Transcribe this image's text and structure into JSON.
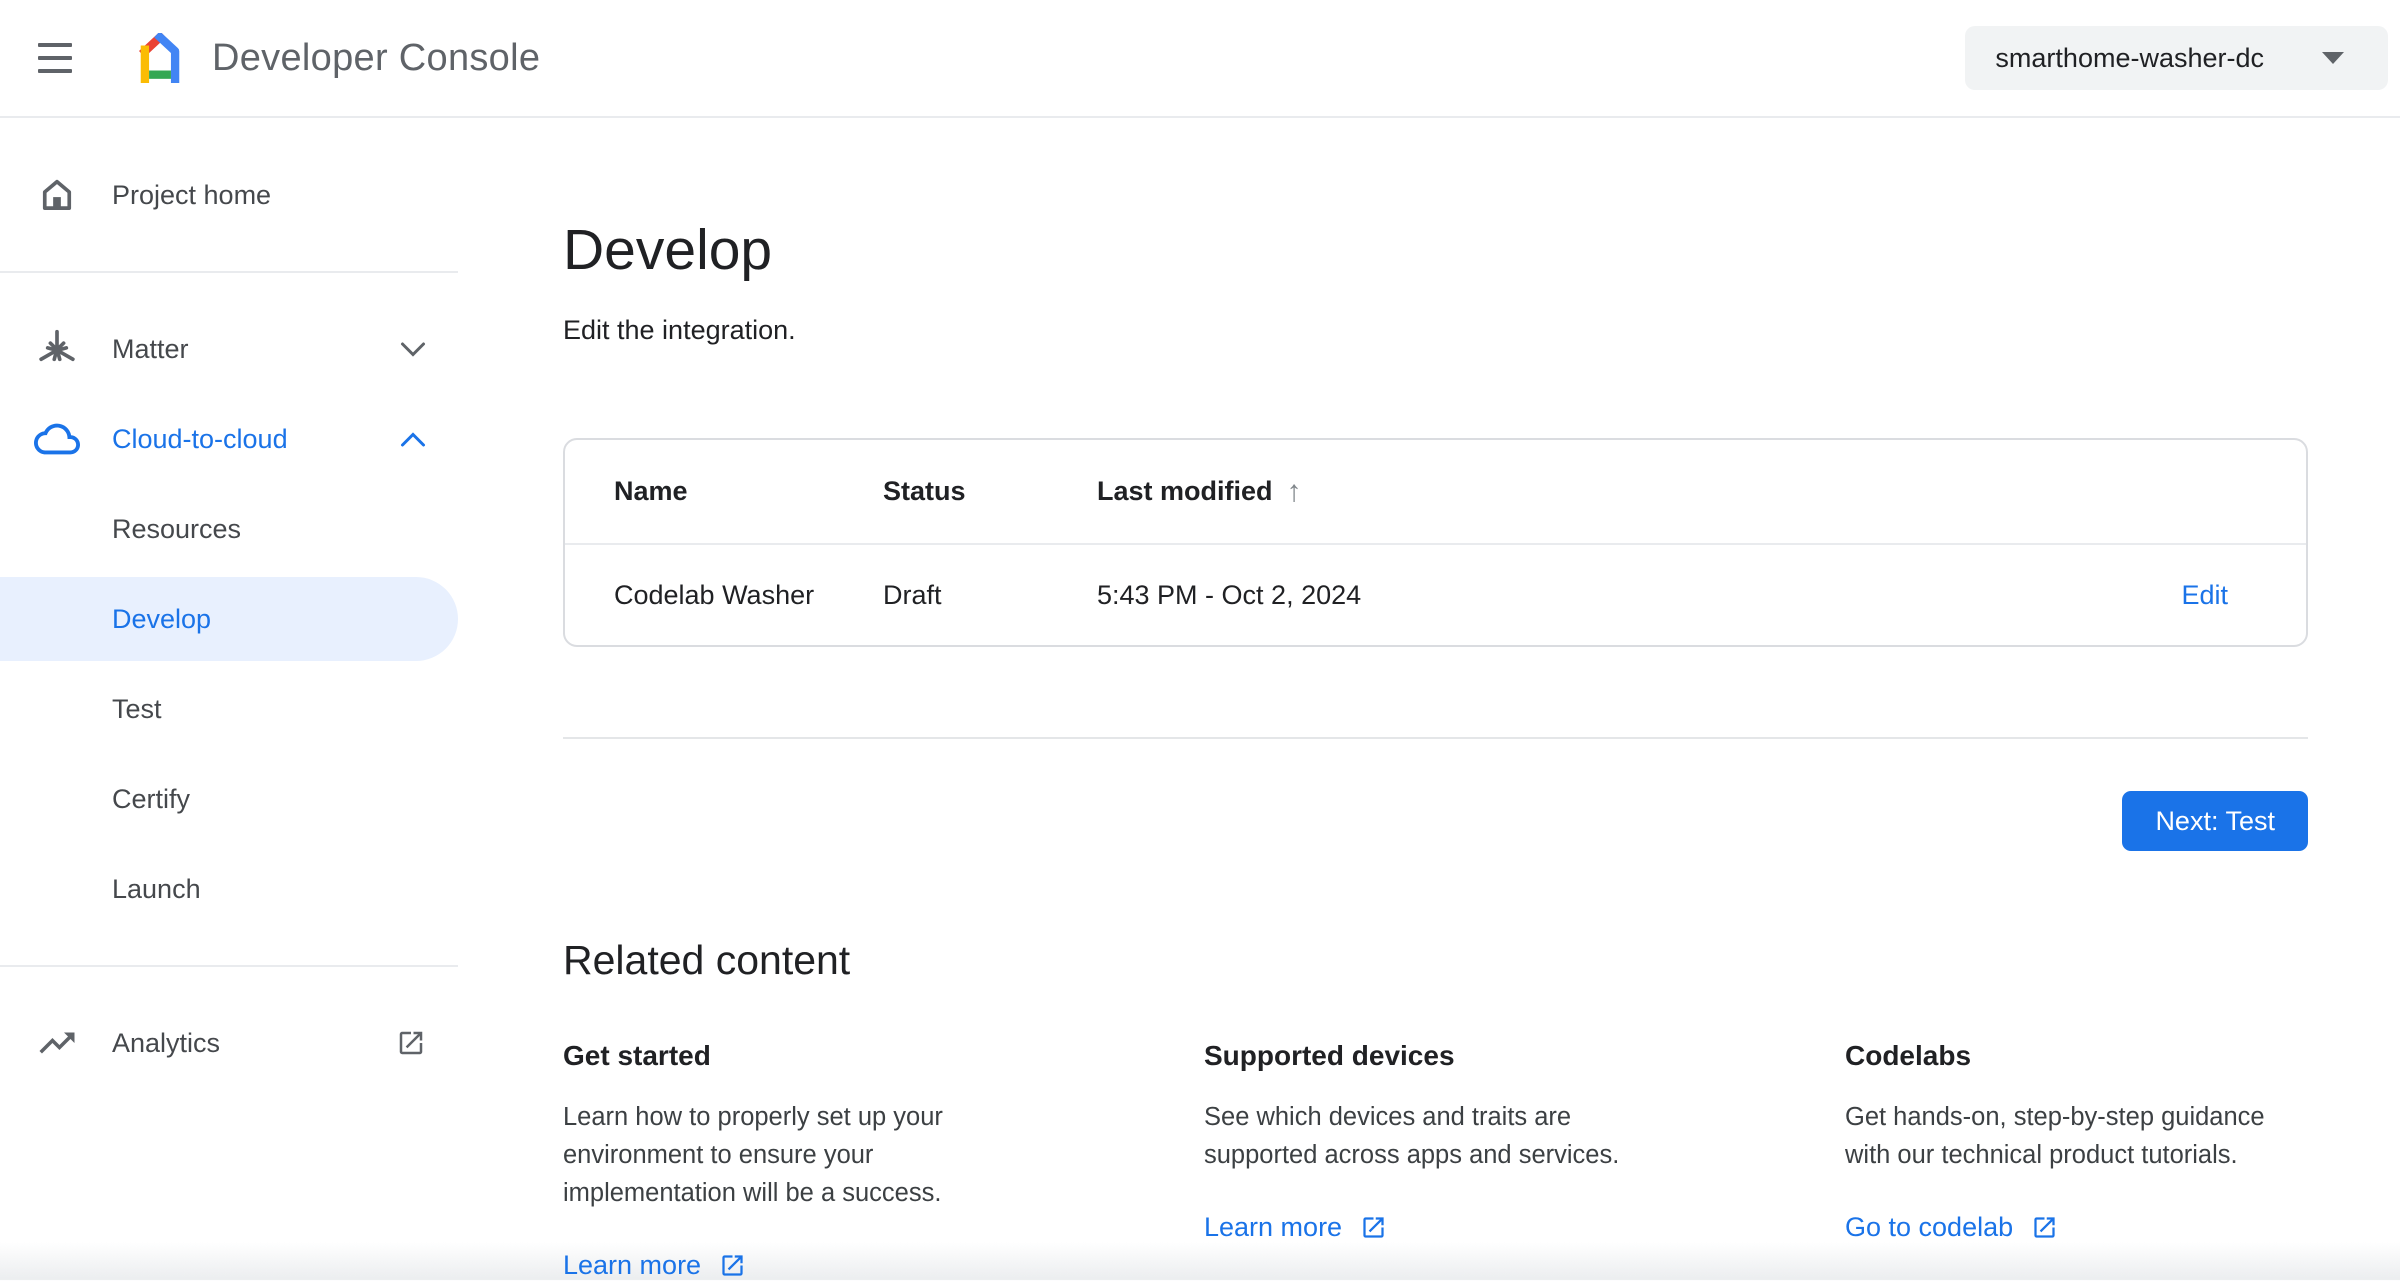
{
  "header": {
    "app_title": "Developer Console",
    "project_selector": {
      "value": "smarthome-washer-dc"
    }
  },
  "sidebar": {
    "items": [
      {
        "label": "Project home",
        "icon": "home-icon"
      },
      {
        "label": "Matter",
        "icon": "matter-icon",
        "chevron": "down",
        "expanded": false
      },
      {
        "label": "Cloud-to-cloud",
        "icon": "cloud-icon",
        "chevron": "up",
        "expanded": true
      },
      {
        "label": "Resources"
      },
      {
        "label": "Develop",
        "selected": true
      },
      {
        "label": "Test"
      },
      {
        "label": "Certify"
      },
      {
        "label": "Launch"
      },
      {
        "label": "Analytics",
        "icon": "trending-up-icon",
        "external": true
      }
    ]
  },
  "main": {
    "title": "Develop",
    "subtitle": "Edit the integration.",
    "table": {
      "columns": [
        "Name",
        "Status",
        "Last modified"
      ],
      "sort": {
        "column": "Last modified",
        "direction": "ascending"
      },
      "rows": [
        {
          "name": "Codelab Washer",
          "status": "Draft",
          "last_modified": "5:43 PM - Oct 2, 2024",
          "action": "Edit"
        }
      ]
    },
    "next_button": "Next: Test",
    "related": {
      "heading": "Related content",
      "cards": [
        {
          "title": "Get started",
          "body": "Learn how to properly set up your environment to ensure your implementation will be a success.",
          "link": "Learn more"
        },
        {
          "title": "Supported devices",
          "body": "See which devices and traits are supported across apps and services.",
          "link": "Learn more"
        },
        {
          "title": "Codelabs",
          "body": "Get hands-on, step-by-step guidance with our technical product tutorials.",
          "link": "Go to codelab"
        }
      ]
    }
  },
  "icons": {
    "sort_ascending": "↑"
  },
  "colors": {
    "accent": "#1a73e8",
    "selected_item_bg": "#e8f0fe",
    "text": "#202124",
    "muted_text": "#5f6368",
    "border": "#dadce0",
    "chip_bg": "#f1f3f4",
    "logo_red": "#EA4335",
    "logo_blue": "#4285F4",
    "logo_yellow": "#FBBC04",
    "logo_green": "#34A853"
  }
}
